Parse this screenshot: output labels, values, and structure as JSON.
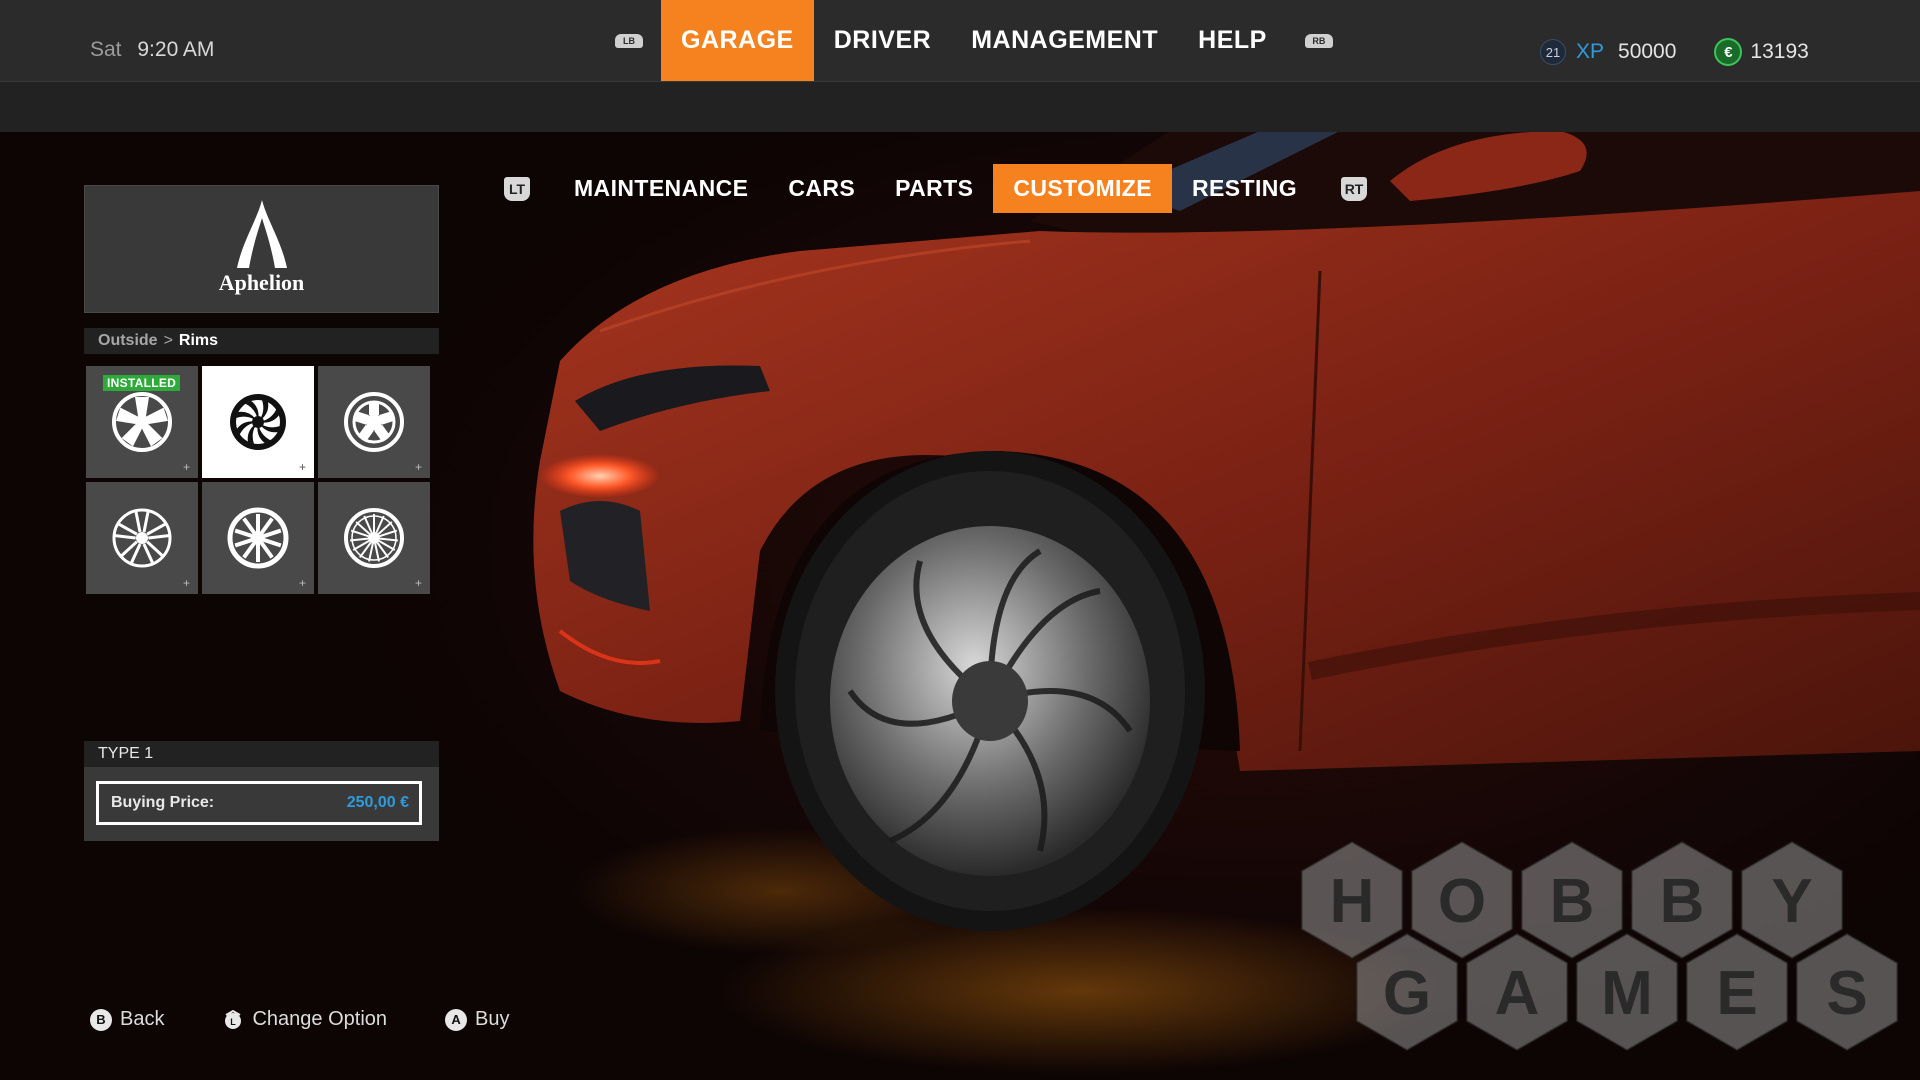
{
  "clock": {
    "day": "Sat",
    "time": "9:20 AM"
  },
  "main_nav": {
    "lb": "LB",
    "rb": "RB",
    "tabs": [
      {
        "label": "GARAGE",
        "active": true
      },
      {
        "label": "DRIVER",
        "active": false
      },
      {
        "label": "MANAGEMENT",
        "active": false
      },
      {
        "label": "HELP",
        "active": false
      }
    ]
  },
  "sub_nav": {
    "lt": "LT",
    "rt": "RT",
    "tabs": [
      {
        "label": "MAINTENANCE",
        "active": false
      },
      {
        "label": "CARS",
        "active": false
      },
      {
        "label": "PARTS",
        "active": false
      },
      {
        "label": "CUSTOMIZE",
        "active": true
      },
      {
        "label": "RESTING",
        "active": false
      }
    ]
  },
  "stats": {
    "level": "21",
    "xp_label": "XP",
    "xp": "50000",
    "currency_symbol": "€",
    "money": "13193"
  },
  "brand": {
    "name": "Aphelion"
  },
  "breadcrumb": {
    "parent": "Outside",
    "separator": ">",
    "current": "Rims"
  },
  "rims": {
    "installed_badge": "INSTALLED",
    "plus": "+",
    "items": [
      {
        "icon": "rim-5-spoke-icon",
        "installed": true,
        "selected": false
      },
      {
        "icon": "rim-turbine-icon",
        "installed": false,
        "selected": true
      },
      {
        "icon": "rim-dish-icon",
        "installed": false,
        "selected": false
      },
      {
        "icon": "rim-split-spoke-icon",
        "installed": false,
        "selected": false
      },
      {
        "icon": "rim-multi-spoke-icon",
        "installed": false,
        "selected": false
      },
      {
        "icon": "rim-mesh-icon",
        "installed": false,
        "selected": false
      }
    ]
  },
  "detail": {
    "type": "TYPE 1",
    "price_label": "Buying Price:",
    "price": "250,00 €"
  },
  "hints": [
    {
      "button": "B",
      "label": "Back"
    },
    {
      "button": "L",
      "label": "Change Option"
    },
    {
      "button": "A",
      "label": "Buy"
    }
  ],
  "watermark": {
    "letters_top": [
      "H",
      "O",
      "B",
      "B",
      "Y"
    ],
    "letters_bottom": [
      "G",
      "A",
      "M",
      "E",
      "S"
    ]
  },
  "colors": {
    "accent": "#f5821f",
    "xp": "#2e9bdd",
    "installed": "#2eaa3b",
    "car_body": "#8a2716"
  }
}
